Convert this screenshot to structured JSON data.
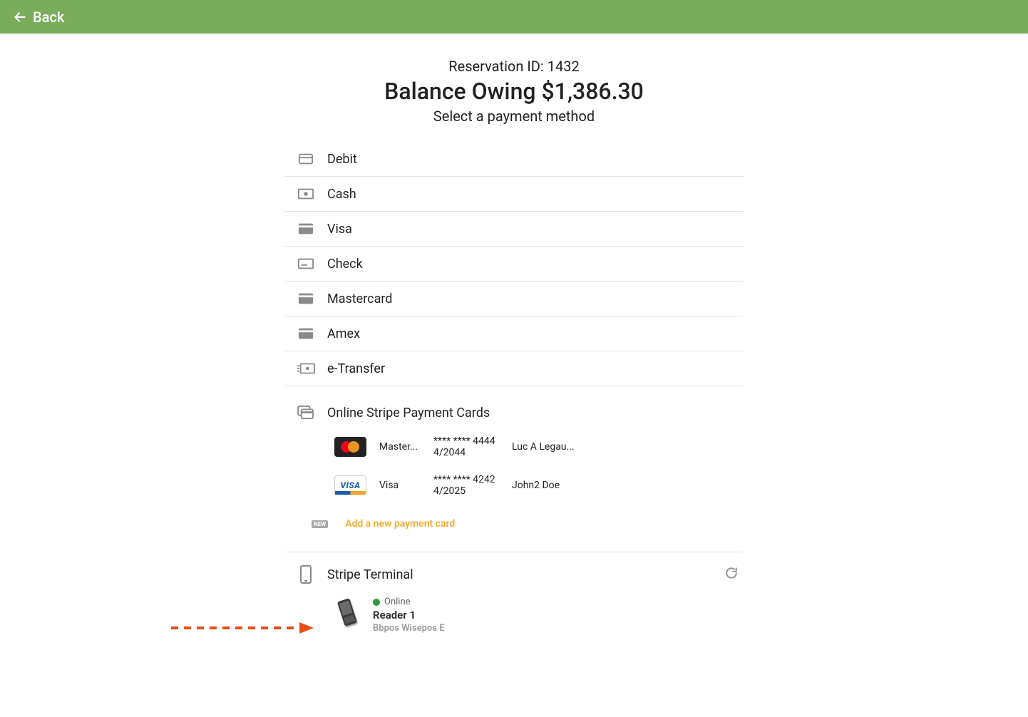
{
  "header": {
    "back_label": "Back"
  },
  "title": {
    "reservation_prefix": "Reservation ID: ",
    "reservation_id": "1432",
    "balance_prefix": "Balance Owing ",
    "balance_amount": "$1,386.30",
    "subtitle": "Select a payment method"
  },
  "methods": {
    "debit": "Debit",
    "cash": "Cash",
    "visa": "Visa",
    "check": "Check",
    "mastercard": "Mastercard",
    "amex": "Amex",
    "etransfer": "e-Transfer"
  },
  "stripe_section": {
    "heading": "Online Stripe Payment Cards",
    "cards": [
      {
        "brand": "Master...",
        "number": "**** **** 4444",
        "expiry": "4/2044",
        "name": "Luc A Legau..."
      },
      {
        "brand": "Visa",
        "number": "**** **** 4242",
        "expiry": "4/2025",
        "name": "John2 Doe"
      }
    ],
    "new_badge": "NEW",
    "add_card": "Add a new payment card"
  },
  "terminal_section": {
    "heading": "Stripe Terminal",
    "reader": {
      "status": "Online",
      "name": "Reader 1",
      "model": "Bbpos Wisepos E"
    }
  }
}
